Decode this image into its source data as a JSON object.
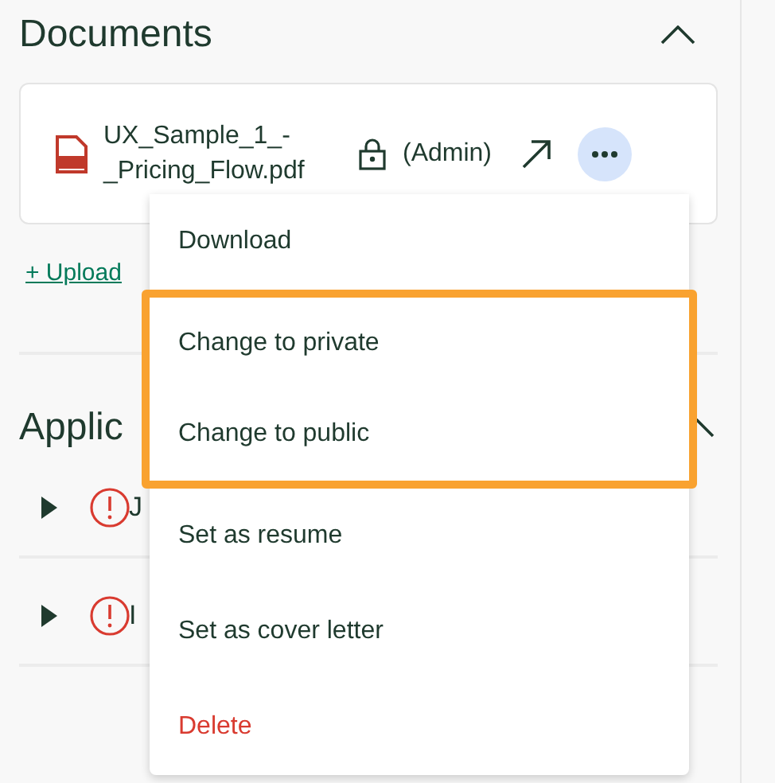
{
  "documents": {
    "title": "Documents",
    "expanded": true,
    "file": {
      "name": "UX_Sample_1_-_Pricing_Flow.pdf",
      "access": "(Admin)"
    },
    "upload_link": "+ Upload"
  },
  "applications": {
    "title": "Applic",
    "rows": [
      {
        "label": "J"
      },
      {
        "label": "I"
      }
    ]
  },
  "menu": {
    "items": [
      {
        "label": "Download",
        "kind": "normal",
        "highlighted": false
      },
      {
        "label": "Change to private",
        "kind": "normal",
        "highlighted": true
      },
      {
        "label": "Change to public",
        "kind": "normal",
        "highlighted": true
      },
      {
        "label": "Set as resume",
        "kind": "normal",
        "highlighted": false
      },
      {
        "label": "Set as cover letter",
        "kind": "normal",
        "highlighted": false
      },
      {
        "label": "Delete",
        "kind": "danger",
        "highlighted": false
      }
    ]
  }
}
